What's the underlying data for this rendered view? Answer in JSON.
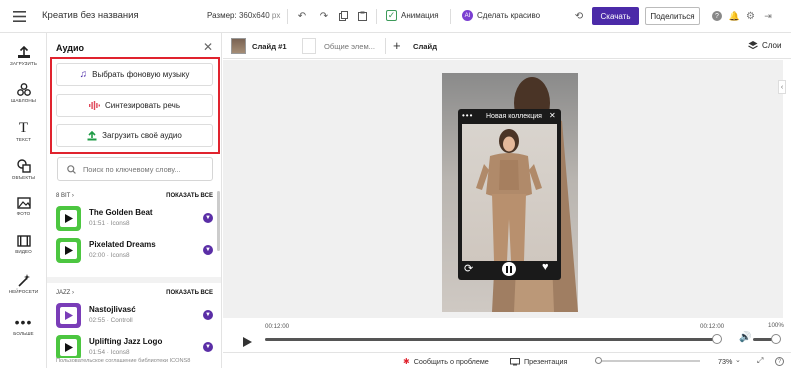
{
  "header": {
    "title": "Креатив без названия",
    "size_label": "Размер:",
    "size_value": "360x640",
    "size_unit": "px",
    "animation_label": "Анимация",
    "beautify_label": "Сделать красиво",
    "download_label": "Скачать",
    "share_label": "Поделиться",
    "accent_color": "#4b2aa8"
  },
  "rail": {
    "items": [
      {
        "label": "ЗАГРУЗИТЬ",
        "icon": "upload-icon"
      },
      {
        "label": "ШАБЛОНЫ",
        "icon": "templates-icon"
      },
      {
        "label": "ТЕКСТ",
        "icon": "text-icon"
      },
      {
        "label": "ОБЪЕКТЫ",
        "icon": "objects-icon"
      },
      {
        "label": "ФОТО",
        "icon": "photo-icon"
      },
      {
        "label": "ВИДЕО",
        "icon": "video-icon"
      },
      {
        "label": "НЕЙРОСЕТИ",
        "icon": "ai-wand-icon"
      },
      {
        "label": "БОЛЬШЕ",
        "icon": "more-icon"
      }
    ]
  },
  "audio_panel": {
    "title": "Аудио",
    "actions": [
      {
        "label": "Выбрать фоновую музыку",
        "icon": "music-note-icon",
        "color": "#4b2aa8"
      },
      {
        "label": "Синтезировать речь",
        "icon": "waveform-icon",
        "color": "#e0485a"
      },
      {
        "label": "Загрузить своё аудио",
        "icon": "upload-arrow-icon",
        "color": "#1e9b45"
      }
    ],
    "search_placeholder": "Поиск по ключевому слову...",
    "sections": [
      {
        "name": "8 BIT",
        "show_all": "ПОКАЗАТЬ ВСЕ",
        "tracks": [
          {
            "title": "The Golden Beat",
            "meta": "01:51 · Icons8",
            "thumb_color": "#4cc640"
          },
          {
            "title": "Pixelated Dreams",
            "meta": "02:00 · Icons8",
            "thumb_color": "#4cc640"
          }
        ]
      },
      {
        "name": "JAZZ",
        "show_all": "ПОКАЗАТЬ ВСЕ",
        "tracks": [
          {
            "title": "Nastojlivasć",
            "meta": "02:55 · Controll",
            "thumb_color": "#7a3db8"
          },
          {
            "title": "Uplifting Jazz Logo",
            "meta": "01:54 · Icons8",
            "thumb_color": "#4cc640"
          }
        ]
      }
    ],
    "footer_text": "Пользовательское соглашение библиотеки ICONS8"
  },
  "slides": {
    "current": "Слайд #1",
    "common": "Общие элем...",
    "add": "Слайд",
    "layers": "Слои"
  },
  "preview": {
    "collection_title": "Новая коллекция"
  },
  "timeline": {
    "start_time": "00:12:00",
    "end_time": "00:12:00",
    "volume": "100%",
    "progress": 1.0
  },
  "status": {
    "report": "Сообщить о проблеме",
    "presentation": "Презентация",
    "zoom": "73%"
  }
}
